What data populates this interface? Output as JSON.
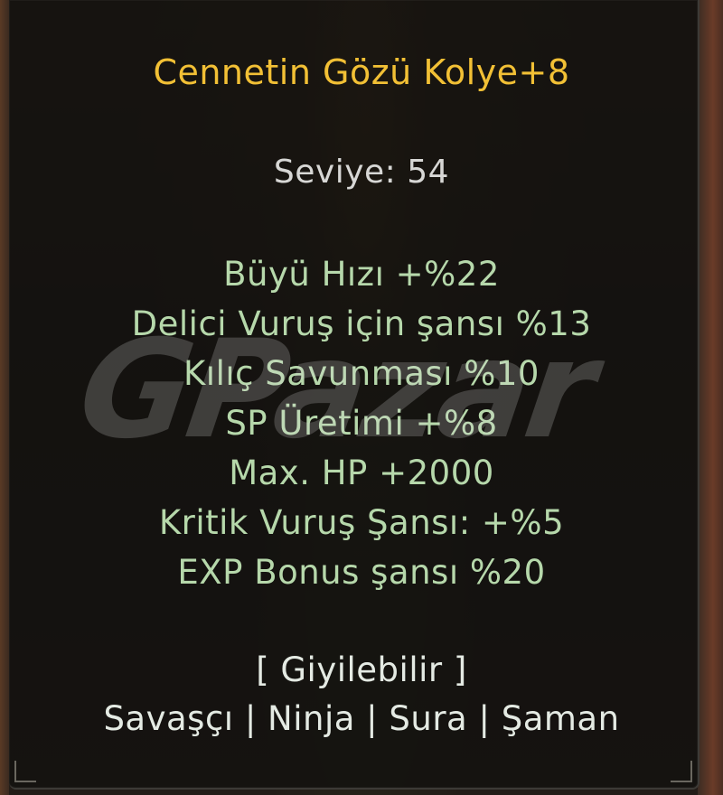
{
  "item": {
    "name": "Cennetin Gözü Kolye+8",
    "level": "Seviye: 54",
    "bonuses": [
      "Büyü Hızı +%22",
      "Delici Vuruş için şansı %13",
      "Kılıç Savunması %10",
      "SP Üretimi +%8",
      "Max. HP +2000",
      "Kritik Vuruş Şansı: +%5",
      "EXP Bonus şansı %20"
    ],
    "wearable": "[ Giyilebilir ]",
    "classes": "Savaşçı | Ninja | Sura | Şaman"
  },
  "watermark": "GPazar",
  "colors": {
    "title": "#f2c035",
    "level": "#d7d7d5",
    "bonus": "#b6d8ab",
    "wearable": "#e4eae3"
  }
}
